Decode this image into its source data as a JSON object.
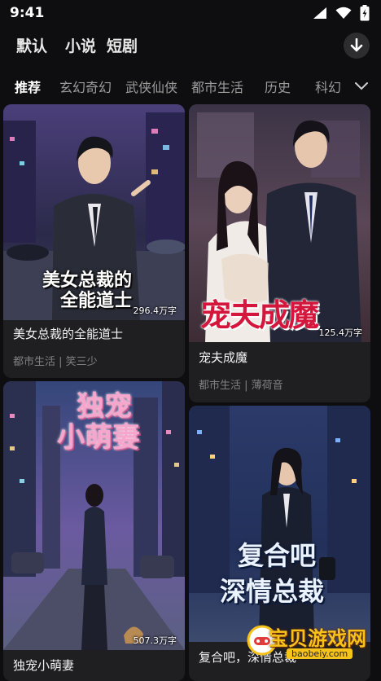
{
  "status": {
    "time": "9:41"
  },
  "top_tabs": [
    "默认",
    "小说",
    "短剧"
  ],
  "categories": [
    "推荐",
    "玄幻奇幻",
    "武侠仙侠",
    "都市生活",
    "历史",
    "科幻"
  ],
  "books": [
    {
      "cover_title_line1": "美女总裁的",
      "cover_title_line2": "全能道士",
      "word_count": "296.4万字",
      "title": "美女总裁的全能道士",
      "meta": "都市生活 | 笑三少"
    },
    {
      "cover_title": "宠夫成魔",
      "word_count": "125.4万字",
      "title": "宠夫成魔",
      "meta": "都市生活 | 薄荷音"
    },
    {
      "cover_title_line1": "独宠",
      "cover_title_line2": "小萌妻",
      "word_count": "507.3万字",
      "title": "独宠小萌妻"
    },
    {
      "cover_title_line1": "复合吧",
      "cover_title_line2": "深情总裁",
      "title": "复合吧，深情总裁"
    }
  ],
  "watermark": {
    "text": "宝贝游戏网",
    "url": "baobeiy.com"
  }
}
